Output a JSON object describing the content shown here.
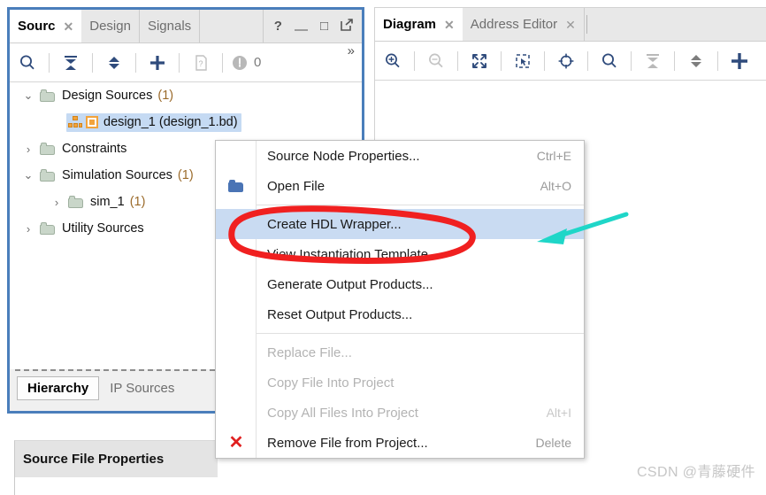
{
  "sources_panel": {
    "tabs": [
      {
        "label": "Sourc",
        "active": true,
        "closable": true
      },
      {
        "label": "Design",
        "active": false,
        "closable": false
      },
      {
        "label": "Signals",
        "active": false,
        "closable": false
      }
    ],
    "window_controls": [
      {
        "name": "help-icon",
        "glyph": "?"
      },
      {
        "name": "minimize-icon",
        "glyph": "—"
      },
      {
        "name": "maximize-icon",
        "glyph": "□"
      },
      {
        "name": "float-icon",
        "glyph": "↗"
      }
    ],
    "toolbar": {
      "buttons": [
        {
          "name": "search-icon",
          "glyph": "⚲"
        },
        {
          "name": "collapse-all-icon",
          "glyph": "⨗"
        },
        {
          "name": "expand-all-icon",
          "glyph": "⬍"
        },
        {
          "name": "add-sources-icon",
          "glyph": "+"
        },
        {
          "name": "file-help-icon",
          "glyph": "?"
        }
      ],
      "status_count": "0",
      "overflow_glyph": "»"
    },
    "tree": [
      {
        "indent": 0,
        "twist": "⌄",
        "icon": "folder",
        "label": "Design Sources",
        "count": "(1)",
        "selected": false
      },
      {
        "indent": 1,
        "twist": "",
        "icon": "design",
        "label": "design_1 (design_1.bd)",
        "count": "",
        "selected": true
      },
      {
        "indent": 0,
        "twist": "›",
        "icon": "folder",
        "label": "Constraints",
        "count": "",
        "selected": false
      },
      {
        "indent": 0,
        "twist": "⌄",
        "icon": "folder",
        "label": "Simulation Sources",
        "count": "(1)",
        "selected": false
      },
      {
        "indent": 1,
        "twist": "›",
        "icon": "folder",
        "label": "sim_1",
        "count": "(1)",
        "selected": false
      },
      {
        "indent": 0,
        "twist": "›",
        "icon": "folder",
        "label": "Utility Sources",
        "count": "",
        "selected": false
      }
    ],
    "bottom_tabs": [
      {
        "label": "Hierarchy",
        "active": true
      },
      {
        "label": "IP Sources",
        "active": false
      }
    ]
  },
  "source_file_properties": {
    "title": "Source File Properties"
  },
  "diagram_panel": {
    "tabs": [
      {
        "label": "Diagram",
        "active": true,
        "closable": true
      },
      {
        "label": "Address Editor",
        "active": false,
        "closable": true
      }
    ],
    "toolbar": {
      "buttons": [
        {
          "name": "zoom-in-icon",
          "glyph": "⊕"
        },
        {
          "name": "zoom-out-icon",
          "glyph": "⊖"
        },
        {
          "name": "fit-to-screen-icon",
          "glyph": "⬌"
        },
        {
          "name": "select-area-icon",
          "glyph": "⬚"
        },
        {
          "name": "center-view-icon",
          "glyph": "⊕"
        },
        {
          "name": "search-icon",
          "glyph": "⚲"
        },
        {
          "name": "collapse-all-icon",
          "glyph": "⨗"
        },
        {
          "name": "expand-all-icon",
          "glyph": "⬍"
        },
        {
          "name": "add-ip-icon",
          "glyph": "+"
        }
      ]
    }
  },
  "context_menu": {
    "items": [
      {
        "label": "Source Node Properties...",
        "shortcut": "Ctrl+E",
        "icon": "",
        "disabled": false,
        "highlight": false
      },
      {
        "label": "Open File",
        "shortcut": "Alt+O",
        "icon": "folder-blue",
        "disabled": false,
        "highlight": false
      },
      {
        "separator": true
      },
      {
        "label": "Create HDL Wrapper...",
        "shortcut": "",
        "icon": "",
        "disabled": false,
        "highlight": true
      },
      {
        "label": "View Instantiation Template",
        "shortcut": "",
        "icon": "",
        "disabled": false,
        "highlight": false
      },
      {
        "label": "Generate Output Products...",
        "shortcut": "",
        "icon": "",
        "disabled": false,
        "highlight": false
      },
      {
        "label": "Reset Output Products...",
        "shortcut": "",
        "icon": "",
        "disabled": false,
        "highlight": false
      },
      {
        "separator": true
      },
      {
        "label": "Replace File...",
        "shortcut": "",
        "icon": "",
        "disabled": true,
        "highlight": false
      },
      {
        "label": "Copy File Into Project",
        "shortcut": "",
        "icon": "",
        "disabled": true,
        "highlight": false
      },
      {
        "label": "Copy All Files Into Project",
        "shortcut": "Alt+I",
        "icon": "",
        "disabled": true,
        "highlight": false
      },
      {
        "label": "Remove File from Project...",
        "shortcut": "Delete",
        "icon": "x-red",
        "disabled": false,
        "highlight": false
      }
    ]
  },
  "annotations": {
    "ellipse_color": "#f02020",
    "arrow_color": "#1fd6c8",
    "target_label": "Create HDL Wrapper..."
  },
  "watermark": {
    "text": "CSDN @青藤硬件",
    "color": "#c6c6c6"
  }
}
